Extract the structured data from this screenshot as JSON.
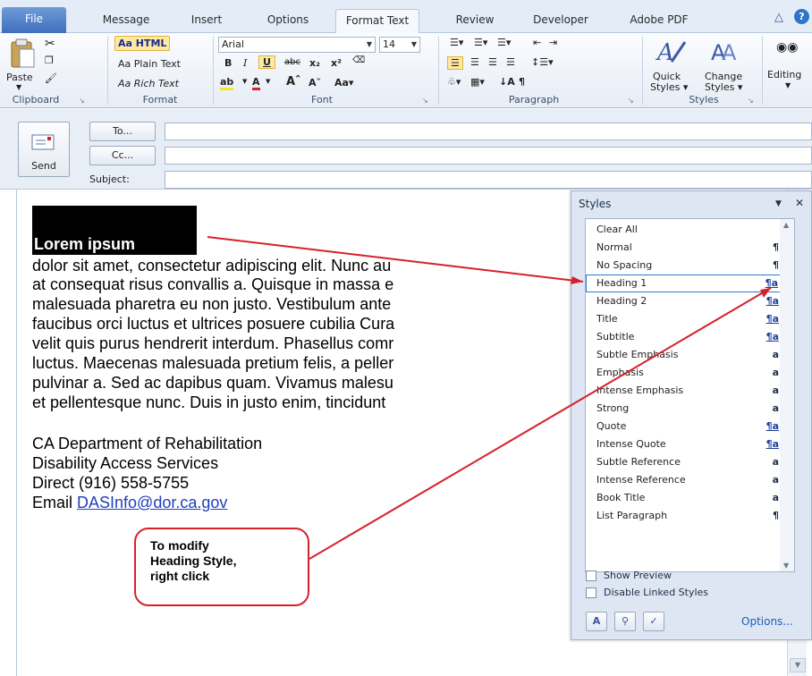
{
  "tabs": [
    "File",
    "Message",
    "Insert",
    "Options",
    "Format Text",
    "Review",
    "Developer",
    "Adobe PDF"
  ],
  "active_tab": "Format Text",
  "ribbon": {
    "clipboard": {
      "paste_label": "Paste",
      "group_label": "Clipboard"
    },
    "format": {
      "html_label": "Aa HTML",
      "plain_label": "Aa Plain Text",
      "rich_label": "Aa Rich Text",
      "group_label": "Format"
    },
    "font": {
      "font_name": "Arial",
      "font_size": "14",
      "group_label": "Font"
    },
    "paragraph": {
      "group_label": "Paragraph"
    },
    "styles": {
      "quick_label_1": "Quick",
      "quick_label_2": "Styles",
      "change_label_1": "Change",
      "change_label_2": "Styles",
      "group_label": "Styles"
    },
    "editing": {
      "label": "Editing"
    }
  },
  "header": {
    "send_label": "Send",
    "to_label": "To...",
    "cc_label": "Cc...",
    "subject_label": "Subject:",
    "to_value": "",
    "cc_value": "",
    "subject_value": ""
  },
  "body": {
    "heading": "Lorem ipsum",
    "lines": [
      "dolor sit amet, consectetur adipiscing elit. Nunc au",
      "at consequat risus convallis a. Quisque in massa e",
      "malesuada pharetra eu non justo. Vestibulum ante",
      "faucibus orci luctus et ultrices posuere cubilia Cura",
      "velit quis purus hendrerit interdum. Phasellus comr",
      "luctus. Maecenas malesuada pretium felis, a peller",
      "pulvinar a. Sed ac dapibus quam. Vivamus malesu",
      "et pellentesque nunc. Duis in justo enim, tincidunt"
    ],
    "signature": [
      "CA Department of Rehabilitation",
      "Disability Access Services",
      "Direct (916) 558-5755"
    ],
    "email_prefix": "Email ",
    "email": "DASInfo@dor.ca.gov"
  },
  "styles_pane": {
    "title": "Styles",
    "items": [
      {
        "name": "Clear All",
        "glyph": ""
      },
      {
        "name": "Normal",
        "glyph": "¶"
      },
      {
        "name": "No Spacing",
        "glyph": "¶"
      },
      {
        "name": "Heading 1",
        "glyph": "¶a"
      },
      {
        "name": "Heading 2",
        "glyph": "¶a"
      },
      {
        "name": "Title",
        "glyph": "¶a"
      },
      {
        "name": "Subtitle",
        "glyph": "¶a"
      },
      {
        "name": "Subtle Emphasis",
        "glyph": "a"
      },
      {
        "name": "Emphasis",
        "glyph": "a"
      },
      {
        "name": "Intense Emphasis",
        "glyph": "a"
      },
      {
        "name": "Strong",
        "glyph": "a"
      },
      {
        "name": "Quote",
        "glyph": "¶a"
      },
      {
        "name": "Intense Quote",
        "glyph": "¶a"
      },
      {
        "name": "Subtle Reference",
        "glyph": "a"
      },
      {
        "name": "Intense Reference",
        "glyph": "a"
      },
      {
        "name": "Book Title",
        "glyph": "a"
      },
      {
        "name": "List Paragraph",
        "glyph": "¶"
      }
    ],
    "highlighted": "Heading 1",
    "show_preview_label": "Show Preview",
    "disable_linked_label": "Disable Linked Styles",
    "options_label": "Options..."
  },
  "callout": {
    "text": "To modify\nHeading Style,\nright click"
  },
  "colors": {
    "annotation_red": "#d6212a",
    "link_blue": "#1f3fbf",
    "file_tab": "#3f6fbd"
  }
}
